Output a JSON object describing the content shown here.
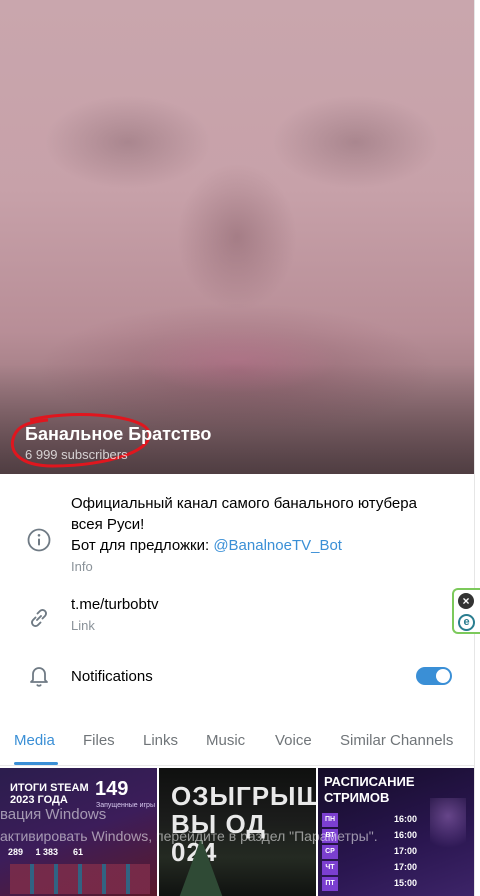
{
  "header": {
    "channel_name": "Банальное Братство",
    "subscribers": "6 999 subscribers"
  },
  "info": {
    "description_line1": "Официальный канал самого банального ютубера",
    "description_line2": "всея Руси!",
    "bot_prefix": "Бот для предложки: ",
    "bot_link": "@BanalnoeTV_Bot",
    "label": "Info",
    "icon": "info-icon"
  },
  "link_row": {
    "url": "t.me/turbobtv",
    "label": "Link",
    "icon": "link-icon"
  },
  "notifications": {
    "label": "Notifications",
    "icon": "bell-icon",
    "enabled": true
  },
  "tabs": [
    {
      "label": "Media",
      "active": true
    },
    {
      "label": "Files"
    },
    {
      "label": "Links"
    },
    {
      "label": "Music"
    },
    {
      "label": "Voice"
    },
    {
      "label": "Similar Channels"
    }
  ],
  "media": {
    "thumb1": {
      "title": "ИТОГИ STEAM 2023 ГОДА",
      "big_number": "149",
      "small": "Запущенные игры",
      "stats": "289     1 383      61"
    },
    "thumb2": {
      "title": "ОЗЫГРЫШ ВЫ ОД 024"
    },
    "thumb3": {
      "title": "РАСПИСАНИЕ СТРИМОВ",
      "days": [
        {
          "d": "ПН",
          "t": "16:00"
        },
        {
          "d": "ВТ",
          "t": "16:00"
        },
        {
          "d": "СР",
          "t": "17:00"
        },
        {
          "d": "ЧТ",
          "t": "17:00"
        },
        {
          "d": "ПТ",
          "t": "15:00"
        }
      ]
    }
  },
  "watermark": {
    "line1": "вация Windows",
    "line2": "активировать Windows, перейдите в раздел \"Параметры\"."
  },
  "colors": {
    "accent": "#3a8fd6",
    "secondary_text": "#8a9299"
  }
}
